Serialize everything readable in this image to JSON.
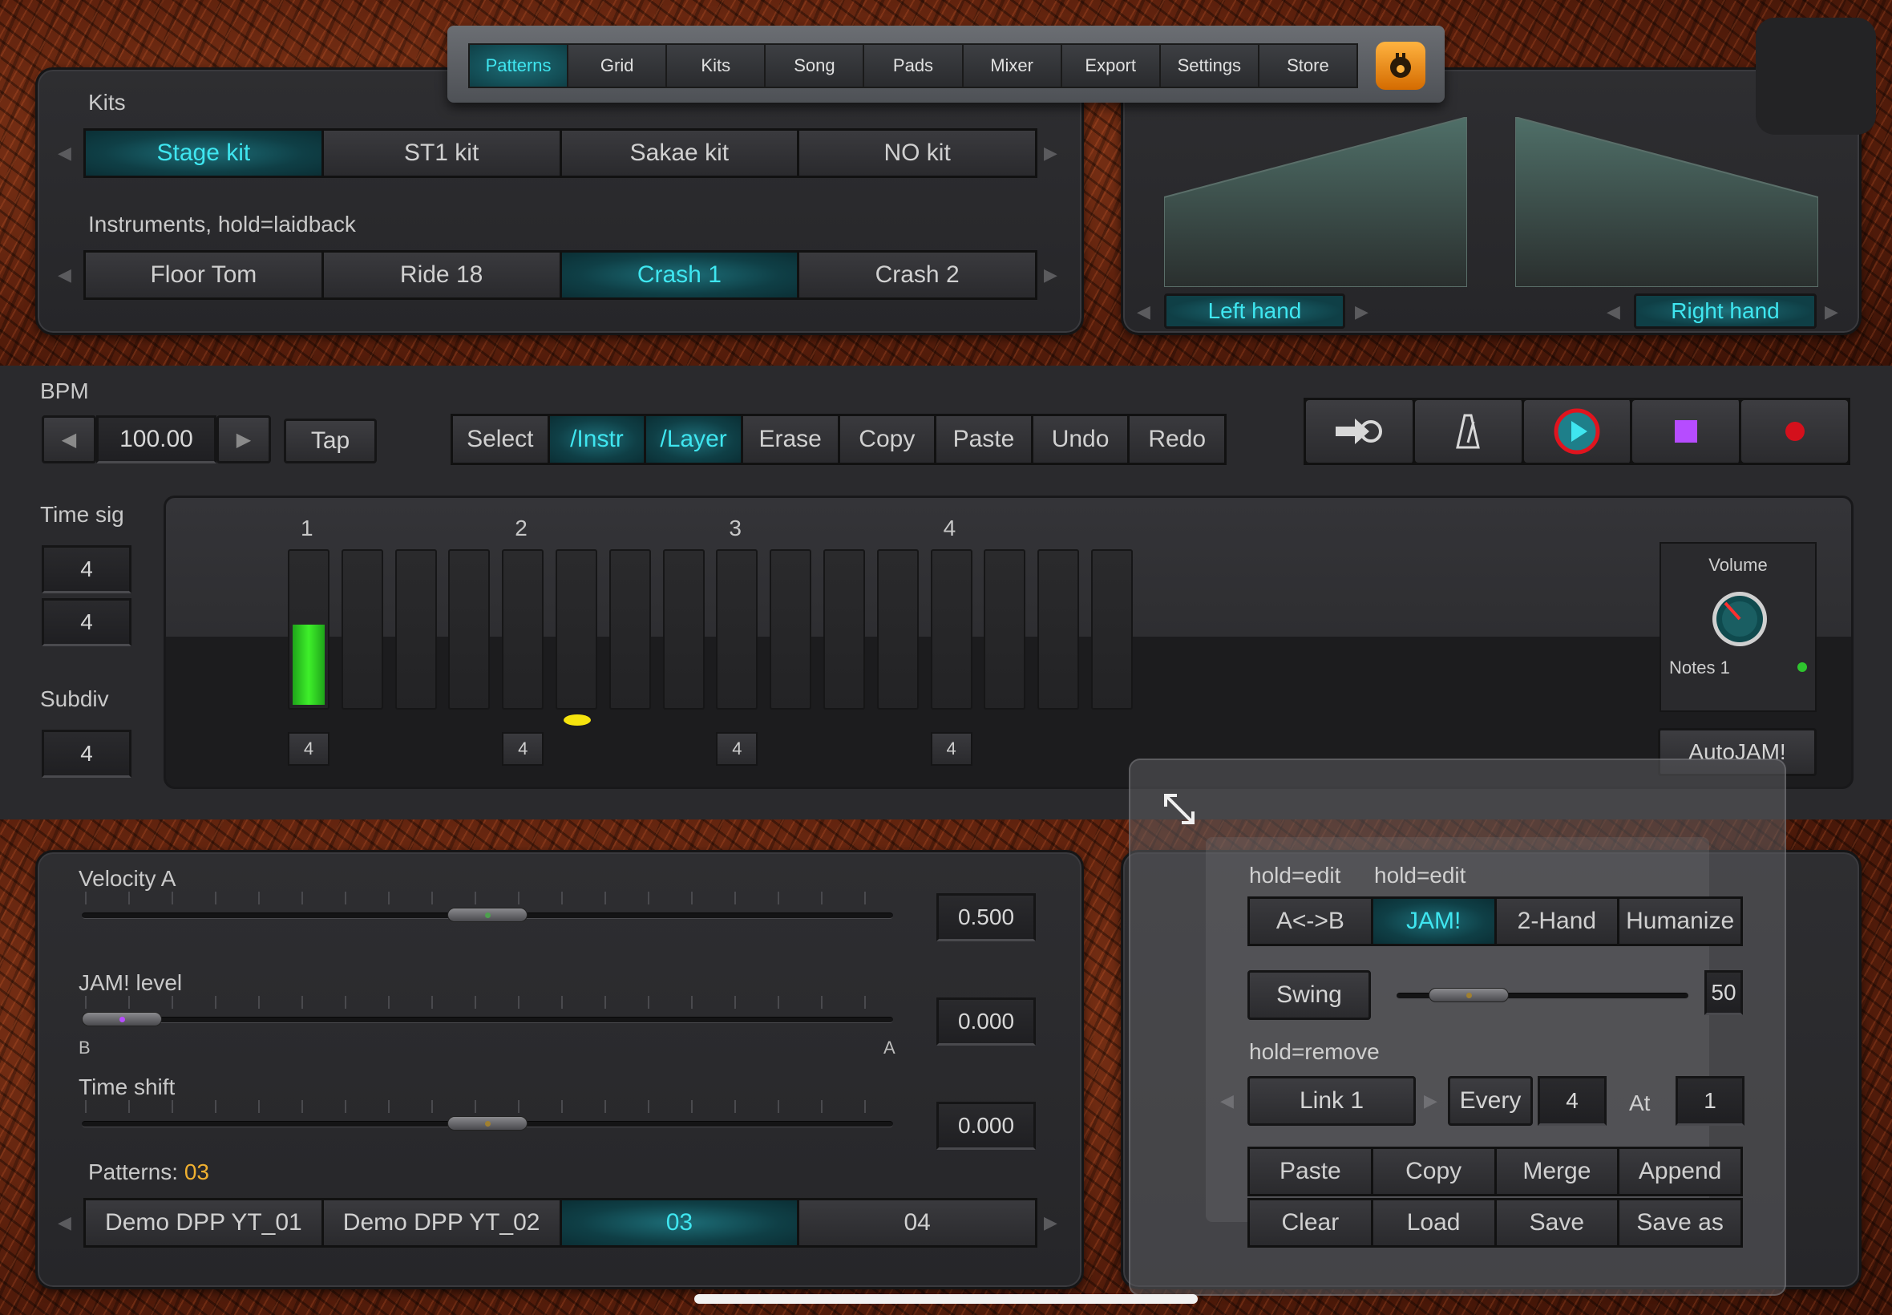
{
  "tabs": {
    "items": [
      "Patterns",
      "Grid",
      "Kits",
      "Song",
      "Pads",
      "Mixer",
      "Export",
      "Settings",
      "Store"
    ],
    "active": "Patterns"
  },
  "kits": {
    "label": "Kits",
    "items": [
      "Stage kit",
      "ST1 kit",
      "Sakae kit",
      "NO kit"
    ],
    "active": "Stage kit"
  },
  "instruments": {
    "label": "Instruments, hold=laidback",
    "items": [
      "Floor Tom",
      "Ride 18",
      "Crash 1",
      "Crash 2"
    ],
    "active": "Crash 1"
  },
  "hands": {
    "left": "Left hand",
    "right": "Right hand"
  },
  "bpm": {
    "label": "BPM",
    "value": "100.00",
    "tap": "Tap"
  },
  "edit_tools": {
    "items": [
      "Select",
      "/Instr",
      "/Layer",
      "Erase",
      "Copy",
      "Paste",
      "Undo",
      "Redo"
    ],
    "active": [
      "/Instr",
      "/Layer"
    ],
    "disabled": [
      "Redo"
    ]
  },
  "transport": {
    "play_color": "#e0141e",
    "stop_color": "#b64cff",
    "record_color": "#d4101c"
  },
  "time_sig": {
    "label": "Time sig",
    "top": "4",
    "bottom": "4"
  },
  "subdiv": {
    "label": "Subdiv",
    "value": "4"
  },
  "grid": {
    "beats": [
      "1",
      "2",
      "3",
      "4"
    ],
    "steps": 16,
    "sub_values": [
      "4",
      "4",
      "4",
      "4"
    ],
    "active_step": 1,
    "active_level": 0.55,
    "playhead_step": 6,
    "accent": "#3ef02a"
  },
  "volume": {
    "label": "Volume",
    "notes": "Notes 1",
    "autojam": "AutoJAM!"
  },
  "sliders": {
    "velocity": {
      "label": "Velocity A",
      "value": "0.500",
      "pos": 0.5
    },
    "jam_level": {
      "label": "JAM! level",
      "value": "0.000",
      "pos": 0.0,
      "left": "B",
      "right": "A"
    },
    "time_shift": {
      "label": "Time shift",
      "value": "0.000",
      "pos": 0.5
    }
  },
  "patterns": {
    "label": "Patterns:",
    "current": "03",
    "items": [
      "Demo DPP YT_01",
      "Demo DPP YT_02",
      "03",
      "04"
    ],
    "active": "03"
  },
  "jam_panel": {
    "hold_edit_1": "hold=edit",
    "hold_edit_2": "hold=edit",
    "modes": [
      "A<->B",
      "JAM!",
      "2-Hand",
      "Humanize"
    ],
    "active_mode": "JAM!",
    "swing": {
      "label": "Swing",
      "value": "50",
      "pos": 0.15
    },
    "hold_remove": "hold=remove",
    "link": "Link 1",
    "every": "Every",
    "every_value": "4",
    "at": "At",
    "at_value": "1",
    "actions_row1": [
      "Paste",
      "Copy",
      "Merge",
      "Append"
    ],
    "actions_row2": [
      "Clear",
      "Load",
      "Save",
      "Save as"
    ]
  }
}
